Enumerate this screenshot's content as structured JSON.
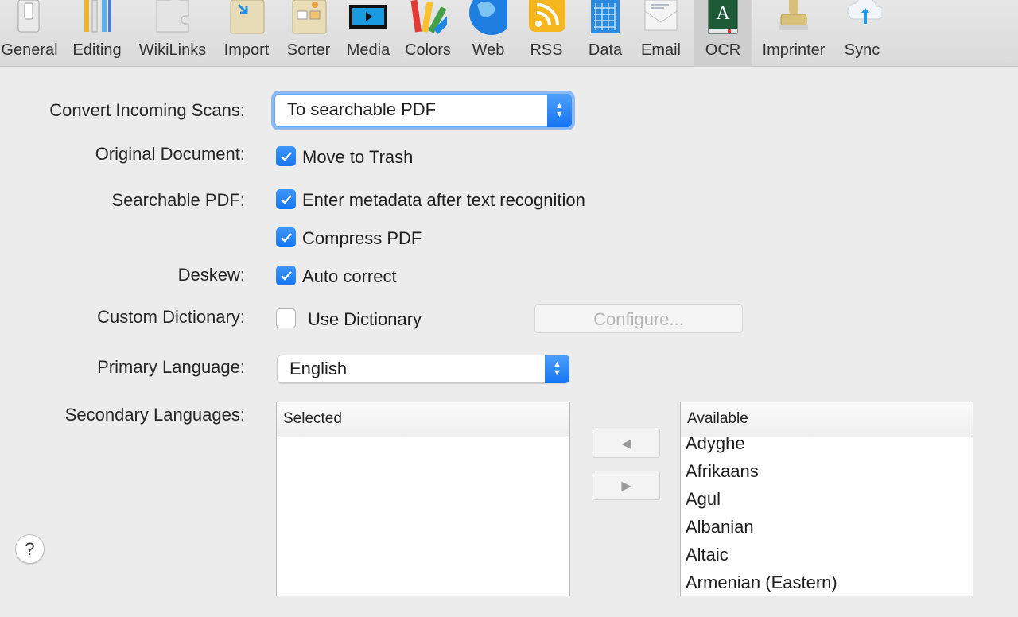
{
  "toolbar": {
    "items": [
      {
        "label": "General",
        "icon": "switch-icon"
      },
      {
        "label": "Editing",
        "icon": "pencils-icon"
      },
      {
        "label": "WikiLinks",
        "icon": "puzzle-icon"
      },
      {
        "label": "Import",
        "icon": "import-icon"
      },
      {
        "label": "Sorter",
        "icon": "sorter-icon"
      },
      {
        "label": "Media",
        "icon": "media-icon"
      },
      {
        "label": "Colors",
        "icon": "color-swatches-icon"
      },
      {
        "label": "Web",
        "icon": "globe-icon"
      },
      {
        "label": "RSS",
        "icon": "rss-icon"
      },
      {
        "label": "Data",
        "icon": "spreadsheet-icon"
      },
      {
        "label": "Email",
        "icon": "envelope-icon"
      },
      {
        "label": "OCR",
        "icon": "ocr-icon"
      },
      {
        "label": "Imprinter",
        "icon": "stamp-icon"
      },
      {
        "label": "Sync",
        "icon": "cloud-sync-icon"
      }
    ],
    "selected": "OCR"
  },
  "form": {
    "convert_label": "Convert Incoming Scans:",
    "convert_value": "To searchable PDF",
    "original_label": "Original Document:",
    "move_to_trash": "Move to Trash",
    "searchable_label": "Searchable PDF:",
    "enter_metadata": "Enter metadata after text recognition",
    "compress_pdf": "Compress PDF",
    "deskew_label": "Deskew:",
    "auto_correct": "Auto correct",
    "dictionary_label": "Custom Dictionary:",
    "use_dictionary": "Use Dictionary",
    "configure_button": "Configure...",
    "primary_label": "Primary Language:",
    "primary_value": "English",
    "secondary_label": "Secondary Languages:"
  },
  "checks": {
    "move_to_trash": true,
    "enter_metadata": true,
    "compress_pdf": true,
    "auto_correct": true,
    "use_dictionary": false
  },
  "lists": {
    "selected_header": "Selected",
    "available_header": "Available",
    "available_items": [
      "Adyghe",
      "Afrikaans",
      "Agul",
      "Albanian",
      "Altaic",
      "Armenian (Eastern)"
    ]
  },
  "help": "?",
  "colors": {
    "accent": "#1576f0",
    "window_bg": "#ececec"
  }
}
